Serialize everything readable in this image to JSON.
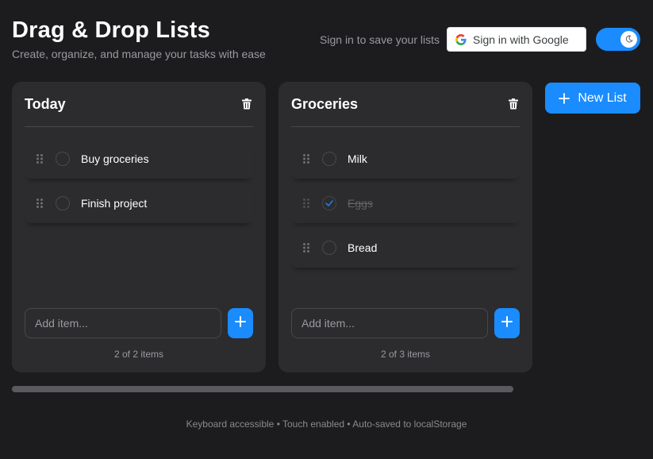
{
  "header": {
    "title": "Drag & Drop Lists",
    "subtitle": "Create, organize, and manage your tasks with ease"
  },
  "auth": {
    "prompt": "Sign in to save your lists",
    "google_button": "Sign in with Google",
    "dark_mode": true
  },
  "lists": [
    {
      "title": "Today",
      "items": [
        {
          "text": "Buy groceries",
          "done": false
        },
        {
          "text": "Finish project",
          "done": false
        }
      ],
      "add_placeholder": "Add item...",
      "count": "2 of 2 items"
    },
    {
      "title": "Groceries",
      "items": [
        {
          "text": "Milk",
          "done": false
        },
        {
          "text": "Eggs",
          "done": true
        },
        {
          "text": "Bread",
          "done": false
        }
      ],
      "add_placeholder": "Add item...",
      "count": "2 of 3 items"
    }
  ],
  "new_list_label": "New List",
  "footer": "Keyboard accessible • Touch enabled • Auto-saved to localStorage",
  "colors": {
    "accent": "#1a8cff",
    "background": "#1c1c1e",
    "card": "#2c2c2e"
  },
  "icons": [
    "google-icon",
    "moon-icon",
    "trash-icon",
    "drag-handle-icon",
    "check-icon",
    "plus-icon"
  ]
}
